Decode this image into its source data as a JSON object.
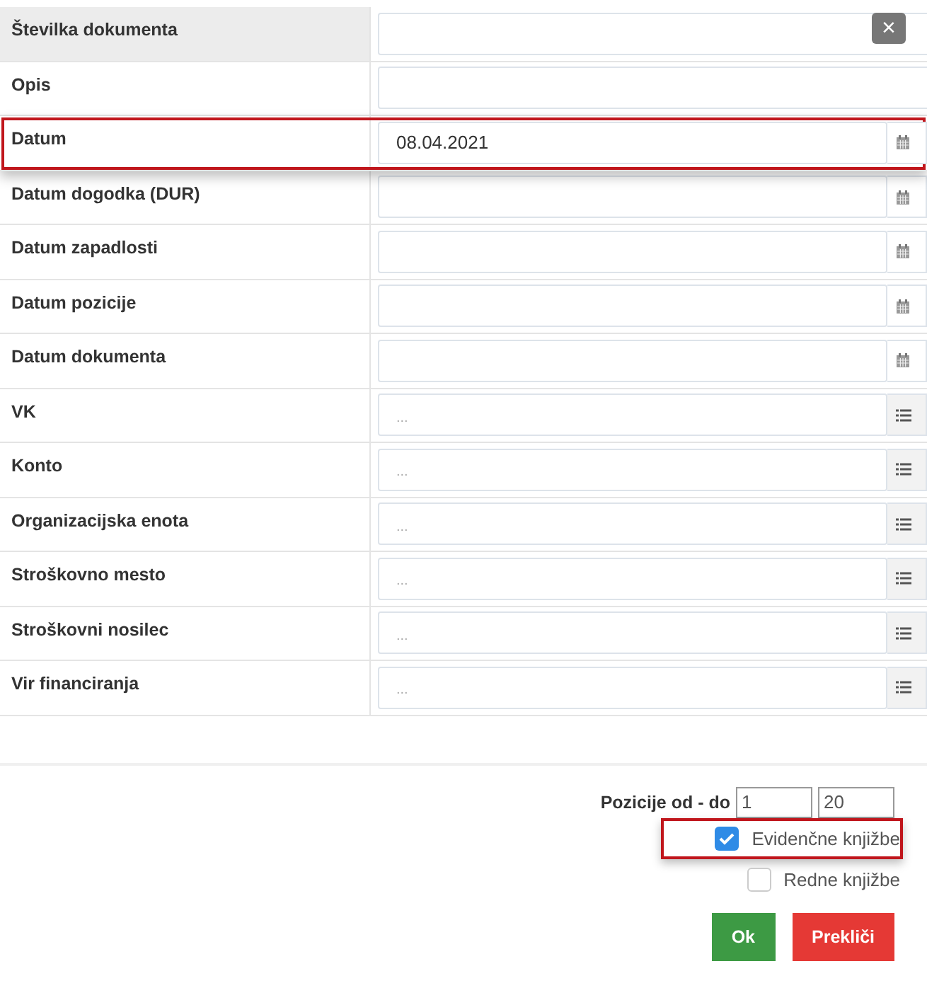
{
  "fields": [
    {
      "label": "Številka dokumenta",
      "kind": "text",
      "hovered": true,
      "highlighted": false,
      "clear_button": "×"
    },
    {
      "label": "Opis",
      "kind": "text",
      "hovered": false,
      "highlighted": false
    },
    {
      "label": "Datum",
      "kind": "date",
      "hovered": false,
      "highlighted": true,
      "value": "08.04.2021"
    },
    {
      "label": "Datum dogodka (DUR)",
      "kind": "date",
      "hovered": false,
      "highlighted": false
    },
    {
      "label": "Datum zapadlosti",
      "kind": "date",
      "hovered": false,
      "highlighted": false
    },
    {
      "label": "Datum pozicije",
      "kind": "date",
      "hovered": false,
      "highlighted": false
    },
    {
      "label": "Datum dokumenta",
      "kind": "date",
      "hovered": false,
      "highlighted": false
    },
    {
      "label": "VK",
      "kind": "list",
      "hovered": false,
      "highlighted": false,
      "placeholder": "..."
    },
    {
      "label": "Konto",
      "kind": "list",
      "hovered": false,
      "highlighted": false,
      "placeholder": "..."
    },
    {
      "label": "Organizacijska enota",
      "kind": "list",
      "hovered": false,
      "highlighted": false,
      "placeholder": "..."
    },
    {
      "label": "Stroškovno mesto",
      "kind": "list",
      "hovered": false,
      "highlighted": false,
      "placeholder": "..."
    },
    {
      "label": "Stroškovni nosilec",
      "kind": "list",
      "hovered": false,
      "highlighted": false,
      "placeholder": "..."
    },
    {
      "label": "Vir financiranja",
      "kind": "list",
      "hovered": false,
      "highlighted": false,
      "placeholder": "..."
    }
  ],
  "range": {
    "label": "Pozicije od - do",
    "from": "1",
    "to": "20"
  },
  "checkboxes": [
    {
      "label": "Evidenčne knjižbe",
      "checked": true,
      "highlighted": true
    },
    {
      "label": "Redne knjižbe",
      "checked": false,
      "highlighted": false
    }
  ],
  "buttons": [
    {
      "label": "Ok",
      "kind": "ok"
    },
    {
      "label": "Prekliči",
      "kind": "cancel"
    }
  ]
}
